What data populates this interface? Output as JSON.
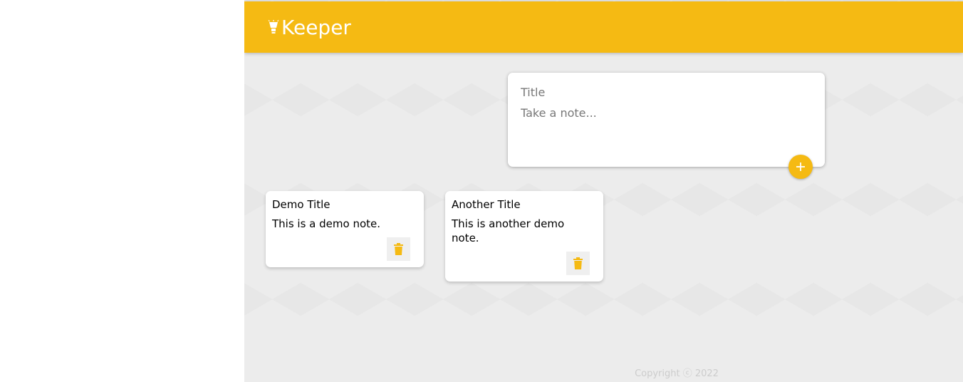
{
  "header": {
    "app_name": "Keeper",
    "logo_icon": "lightbulb-icon",
    "color": "#f5ba13"
  },
  "create_note": {
    "title_placeholder": "Title",
    "content_placeholder": "Take a note...",
    "add_icon": "plus-icon"
  },
  "notes": [
    {
      "title": "Demo Title",
      "content": "This is a demo note.",
      "delete_icon": "trash-icon"
    },
    {
      "title": "Another Title",
      "content": "This is another demo note.",
      "delete_icon": "trash-icon"
    }
  ],
  "footer": {
    "text": "Copyright ⓒ 2022"
  },
  "colors": {
    "accent": "#f5ba13",
    "background": "#ececec"
  }
}
